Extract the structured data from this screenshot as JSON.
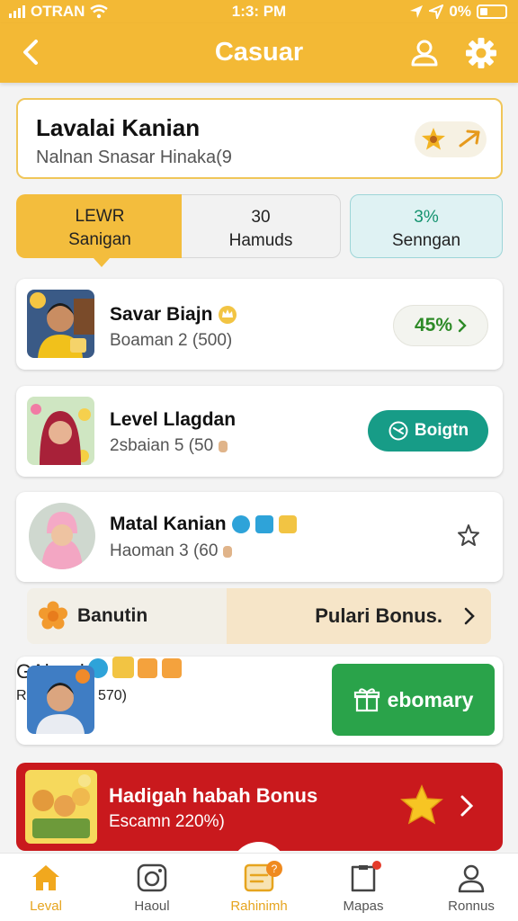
{
  "status_bar": {
    "carrier": "OTRAN",
    "time": "1:3: PM",
    "battery": "0%"
  },
  "header": {
    "title": "Casuar"
  },
  "profile": {
    "name": "Lavalai Kanian",
    "subtitle": "Nalnan Snasar Hinaka(9"
  },
  "segments": [
    {
      "line1": "LEWR",
      "line2": "Sanigan"
    },
    {
      "line1": "30",
      "line2": "Hamuds"
    },
    {
      "line1": "3%",
      "line2": "Senngan"
    }
  ],
  "list": [
    {
      "name": "Savar Biajn",
      "subtitle": "Boaman 2 (500)",
      "action": "45%"
    },
    {
      "name": "Level Llagdan",
      "subtitle": "2sbaian 5 (50",
      "action": "Boigtn"
    },
    {
      "name": "Matal Kanian",
      "subtitle": "Haoman 3 (60",
      "action": ""
    }
  ],
  "bonus_bar": {
    "left_label": "Banutin",
    "right_label": "Pulari Bonus."
  },
  "promo_card": {
    "name": "GAlsayl",
    "subtitle": "Reoglah:",
    "value": "570)",
    "button_label": "ebomary"
  },
  "red_card": {
    "title": "Hadigah habah Bonus",
    "subtitle": "Escamn 220%)"
  },
  "tab_bar": [
    {
      "label": "Leval",
      "icon": "home-icon",
      "active": true
    },
    {
      "label": "Haoul",
      "icon": "camera-icon",
      "active": false
    },
    {
      "label": "Rahinimh",
      "icon": "gift-box-icon",
      "active": false,
      "badge": "?"
    },
    {
      "label": "Mapas",
      "icon": "clipboard-icon",
      "active": false
    },
    {
      "label": "Ronnus",
      "icon": "profile-icon",
      "active": false
    }
  ],
  "colors": {
    "brand_yellow": "#f3b935",
    "teal": "#179c87",
    "green": "#2aa34a",
    "red": "#c9191d"
  }
}
